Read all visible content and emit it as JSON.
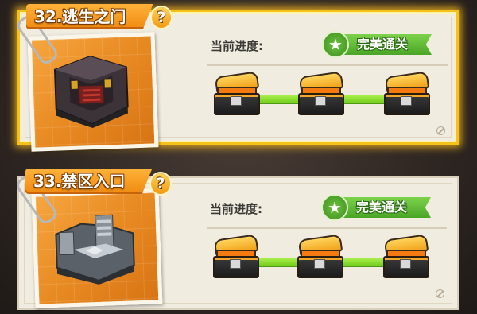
{
  "levels": [
    {
      "title": "32.逃生之门",
      "help_glyph": "?",
      "progress_label": "当前进度:",
      "status": "完美通关",
      "status_icon": "star-icon",
      "selected": true,
      "chests": 3,
      "accent": "#f6c21a"
    },
    {
      "title": "33.禁区入口",
      "help_glyph": "?",
      "progress_label": "当前进度:",
      "status": "完美通关",
      "status_icon": "star-icon",
      "selected": false,
      "chests": 3,
      "accent": "#6cc13e"
    }
  ],
  "colors": {
    "tab_orange": "#f08a10",
    "progress_green": "#6fcb1a",
    "badge_green": "#4aa627"
  }
}
